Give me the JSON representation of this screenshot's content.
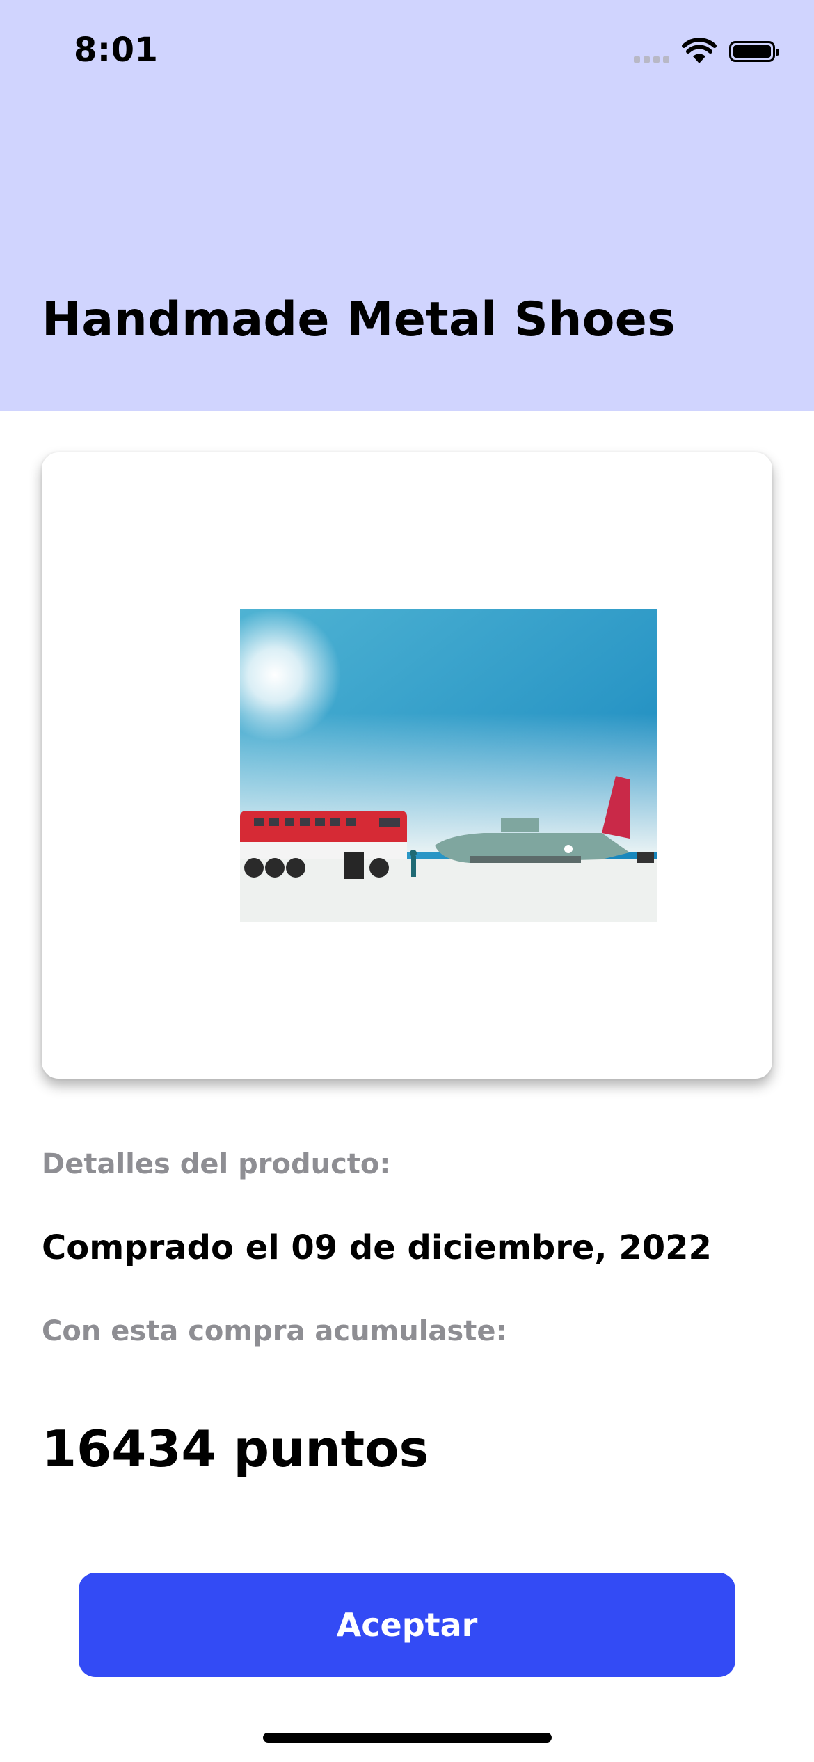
{
  "status_bar": {
    "time": "8:01",
    "icons": [
      "signal-icon",
      "wifi-icon",
      "battery-icon"
    ]
  },
  "header": {
    "title": "Handmade Metal Shoes",
    "background_color": "#d0d4fe"
  },
  "product": {
    "image_icon": "product-photo"
  },
  "details": {
    "section_label": "Detalles del producto:",
    "purchase_date": "Comprado el 09 de diciembre, 2022",
    "points_label": "Con esta compra acumulaste:",
    "points": "16434 puntos"
  },
  "actions": {
    "accept_label": "Aceptar",
    "accent_color": "#334bf5"
  }
}
